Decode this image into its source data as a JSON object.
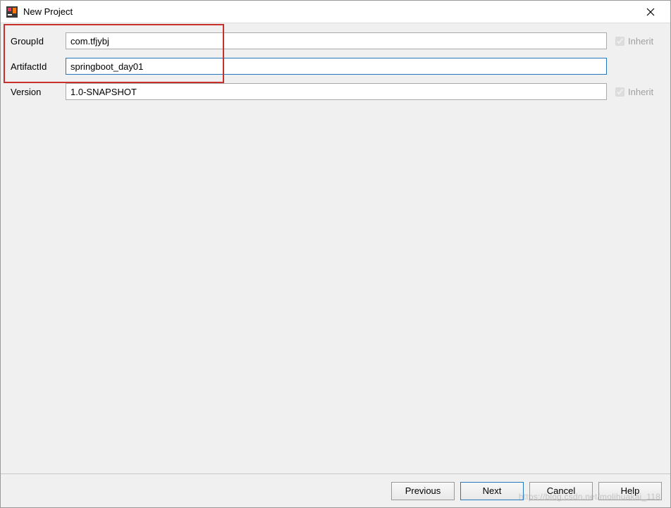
{
  "window": {
    "title": "New Project"
  },
  "form": {
    "groupId": {
      "label": "GroupId",
      "value": "com.tfjybj",
      "inheritLabel": "Inherit",
      "inheritChecked": true
    },
    "artifactId": {
      "label": "ArtifactId",
      "value": "springboot_day01"
    },
    "version": {
      "label": "Version",
      "value": "1.0-SNAPSHOT",
      "inheritLabel": "Inherit",
      "inheritChecked": true
    }
  },
  "buttons": {
    "previous": "Previous",
    "next": "Next",
    "cancel": "Cancel",
    "help": "Help"
  },
  "watermark": "https://blog.csdn.net/molihuakai_118"
}
